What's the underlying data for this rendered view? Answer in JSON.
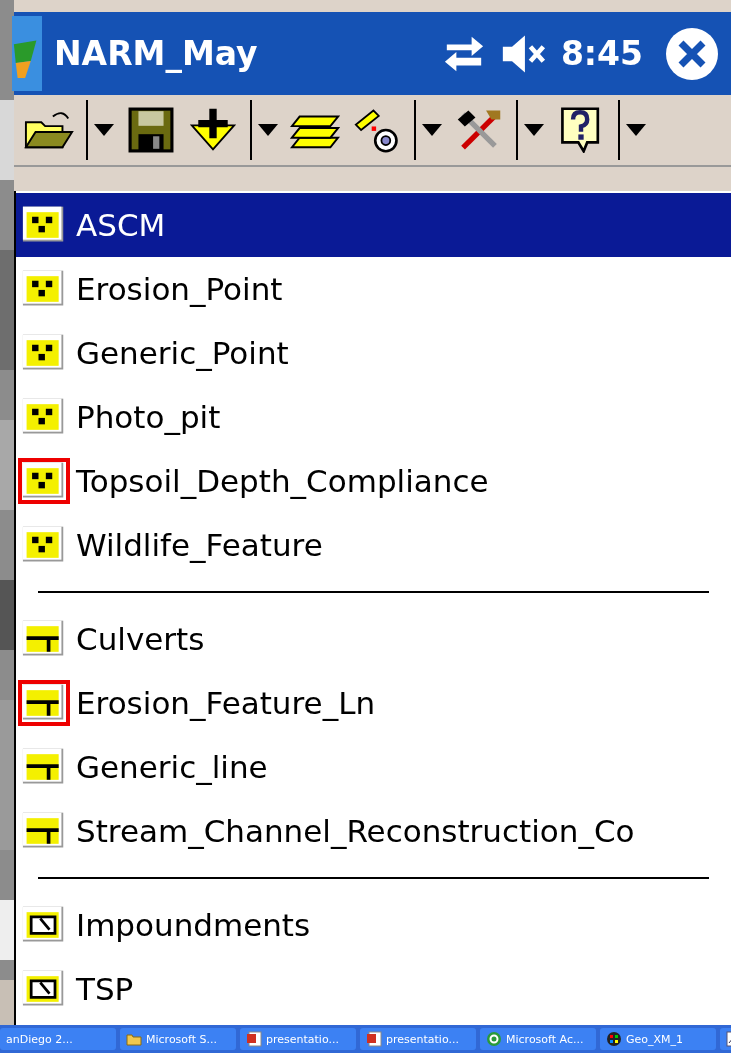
{
  "title_bar": {
    "title": "NARM_May",
    "time": "8:45"
  },
  "menu": {
    "groups": [
      {
        "kind": "point",
        "items": [
          {
            "label": "ASCM",
            "selected": true,
            "highlighted": false
          },
          {
            "label": "Erosion_Point",
            "selected": false,
            "highlighted": false
          },
          {
            "label": "Generic_Point",
            "selected": false,
            "highlighted": false
          },
          {
            "label": "Photo_pit",
            "selected": false,
            "highlighted": false
          },
          {
            "label": "Topsoil_Depth_Compliance",
            "selected": false,
            "highlighted": true
          },
          {
            "label": "Wildlife_Feature",
            "selected": false,
            "highlighted": false
          }
        ]
      },
      {
        "kind": "line",
        "items": [
          {
            "label": "Culverts",
            "selected": false,
            "highlighted": false
          },
          {
            "label": "Erosion_Feature_Ln",
            "selected": false,
            "highlighted": true
          },
          {
            "label": "Generic_line",
            "selected": false,
            "highlighted": false
          },
          {
            "label": "Stream_Channel_Reconstruction_Co",
            "selected": false,
            "highlighted": false
          }
        ]
      },
      {
        "kind": "polygon",
        "items": [
          {
            "label": "Impoundments",
            "selected": false,
            "highlighted": false
          },
          {
            "label": "TSP",
            "selected": false,
            "highlighted": false
          }
        ]
      }
    ]
  },
  "taskbar": [
    {
      "label": "anDiego 2...",
      "kind": "none"
    },
    {
      "label": "Microsoft S...",
      "kind": "folder"
    },
    {
      "label": "presentatio...",
      "kind": "slides"
    },
    {
      "label": "presentatio...",
      "kind": "slides"
    },
    {
      "label": "Microsoft Ac...",
      "kind": "sync"
    },
    {
      "label": "Geo_XM_1",
      "kind": "device"
    },
    {
      "kind": "chart"
    }
  ]
}
